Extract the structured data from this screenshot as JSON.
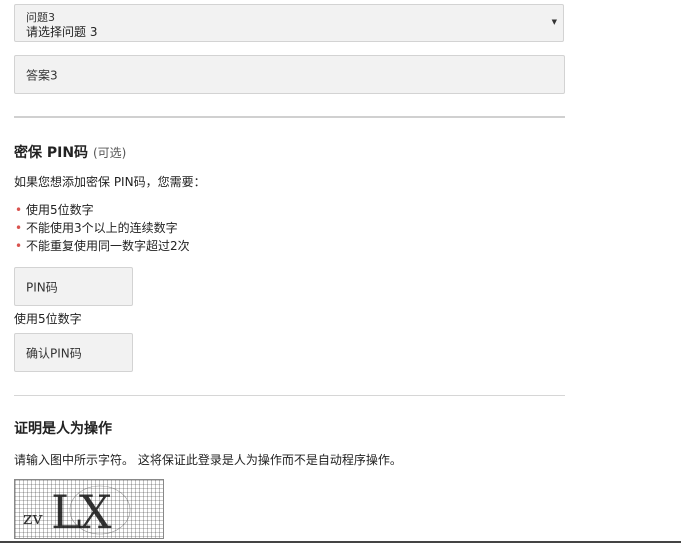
{
  "security_question": {
    "label": "问题3",
    "selected_value": "请选择问题 3",
    "answer_placeholder": "答案3"
  },
  "pin_section": {
    "title": "密保 PIN码",
    "optional_note": "(可选)",
    "intro": "如果您想添加密保 PIN码，您需要：",
    "requirements": [
      "使用5位数字",
      "不能使用3个以上的连续数字",
      "不能重复使用同一数字超过2次"
    ],
    "pin_placeholder": "PIN码",
    "pin_hint": "使用5位数字",
    "confirm_placeholder": "确认PIN码"
  },
  "human_check": {
    "title": "证明是人为操作",
    "instructions": "请输入图中所示字符。 这将保证此登录是人为操作而不是自动程序操作。"
  },
  "colors": {
    "bullet": "#d9534f",
    "field_bg": "#f2f2f2",
    "field_border": "#d3d3d3"
  },
  "icons": {
    "dropdown_caret": "chevron-down-icon",
    "captcha_image": "captcha-image"
  }
}
